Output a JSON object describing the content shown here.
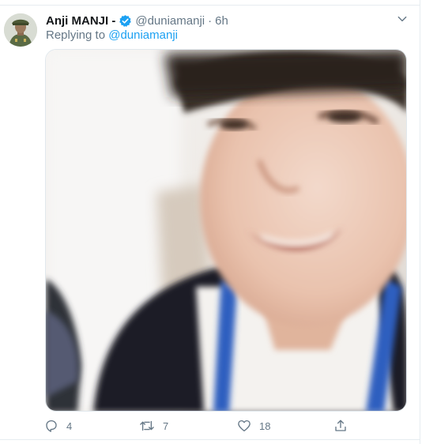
{
  "tweet": {
    "author_name": "Anji MANJI -",
    "handle": "@duniamanji",
    "separator": "·",
    "time": "6h",
    "replying_prefix": "Replying to",
    "replying_to": "@duniamanji",
    "verified": true
  },
  "actions": {
    "reply_count": "4",
    "retweet_count": "7",
    "like_count": "18"
  },
  "icons": {
    "reply": "reply-icon",
    "retweet": "retweet-icon",
    "like": "heart-icon",
    "share": "share-icon",
    "more": "chevron-down-icon",
    "verified": "verified-badge-icon"
  },
  "colors": {
    "name": "#14171a",
    "secondary": "#657786",
    "link": "#1da1f2",
    "verified": "#1da1f2",
    "divider": "#e6ecf0"
  }
}
